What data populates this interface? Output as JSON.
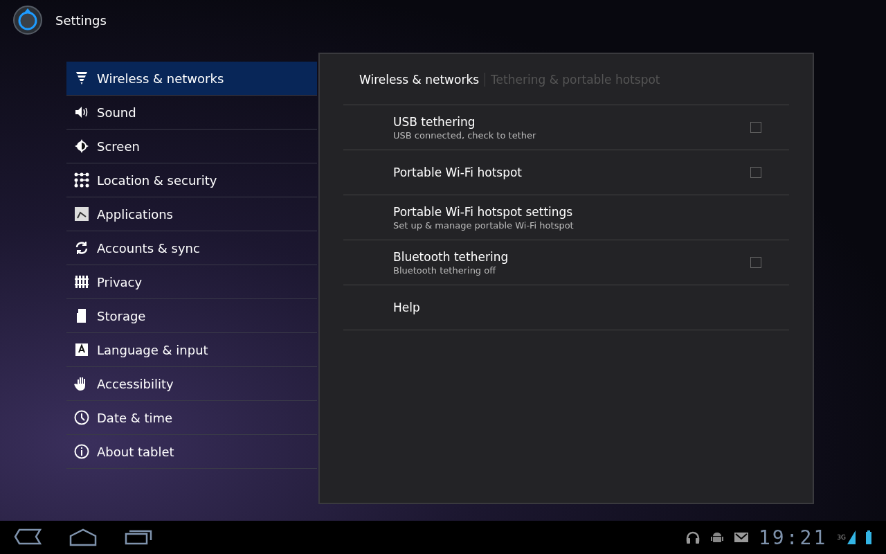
{
  "app_bar": {
    "title": "Settings"
  },
  "sidebar": {
    "items": [
      {
        "label": "Wireless & networks",
        "selected": true
      },
      {
        "label": "Sound",
        "selected": false
      },
      {
        "label": "Screen",
        "selected": false
      },
      {
        "label": "Location & security",
        "selected": false
      },
      {
        "label": "Applications",
        "selected": false
      },
      {
        "label": "Accounts & sync",
        "selected": false
      },
      {
        "label": "Privacy",
        "selected": false
      },
      {
        "label": "Storage",
        "selected": false
      },
      {
        "label": "Language & input",
        "selected": false
      },
      {
        "label": "Accessibility",
        "selected": false
      },
      {
        "label": "Date & time",
        "selected": false
      },
      {
        "label": "About tablet",
        "selected": false
      }
    ]
  },
  "breadcrumb": {
    "parent": "Wireless & networks",
    "current": "Tethering & portable hotspot"
  },
  "preferences": [
    {
      "kind": "checkbox",
      "title": "USB tethering",
      "summary": "USB connected, check to tether",
      "checked": false
    },
    {
      "kind": "checkbox",
      "title": "Portable Wi-Fi hotspot",
      "checked": false
    },
    {
      "kind": "link",
      "title": "Portable Wi-Fi hotspot settings",
      "summary": "Set up & manage portable Wi-Fi hotspot"
    },
    {
      "kind": "checkbox",
      "title": "Bluetooth tethering",
      "summary": "Bluetooth tethering off",
      "checked": false
    },
    {
      "kind": "link",
      "title": "Help"
    }
  ],
  "status_bar": {
    "time": "19:21",
    "network": "3G"
  }
}
